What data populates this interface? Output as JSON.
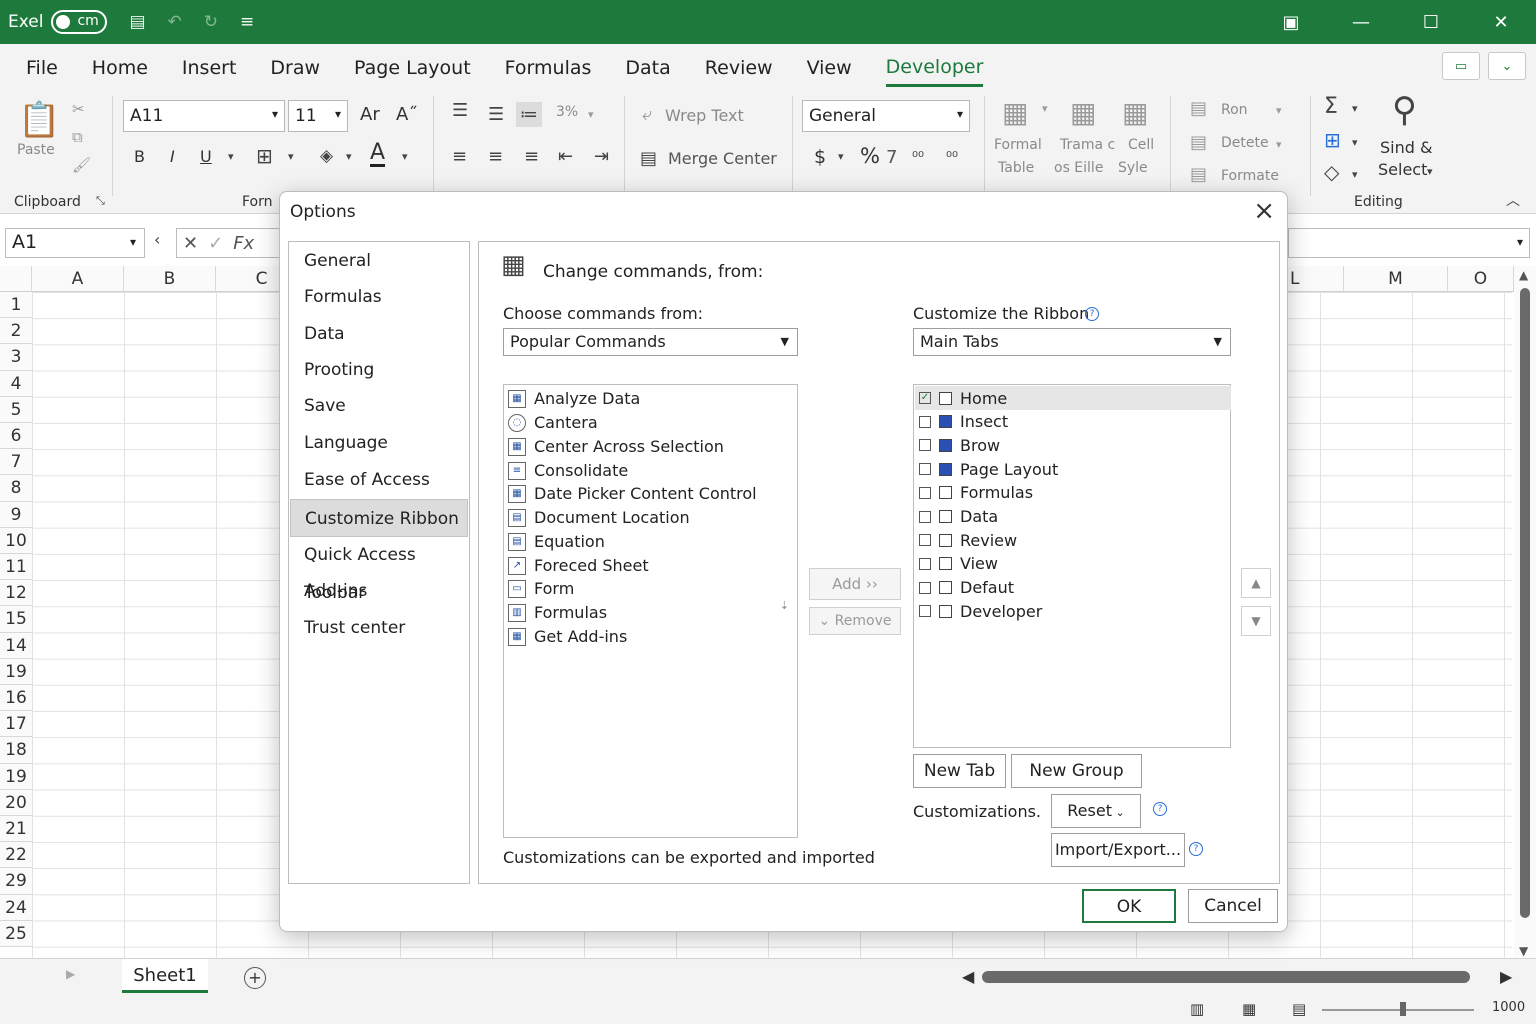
{
  "app": {
    "name": "Exel",
    "autosave_label": "cm"
  },
  "tabs": [
    "File",
    "Home",
    "Insert",
    "Draw",
    "Page Layout",
    "Formulas",
    "Data",
    "Review",
    "View",
    "Developer"
  ],
  "ribbon": {
    "clipboard_label": "Clipboard",
    "paste": "Paste",
    "font_group_label": "Forn",
    "font_name": "A11",
    "font_size": "11",
    "grow": "Ar",
    "shrink": "A˝",
    "bold": "B",
    "italic": "I",
    "underline": "U",
    "font_color": "A",
    "indent_pct": "3%",
    "wrap_text": "Wrep Text",
    "merge_center": "Merge Center",
    "number_format": "General",
    "currency": "$",
    "percent": "%",
    "comma": "7",
    "formal_table": "Formal",
    "formal_table2": "Table",
    "trama": "Trama c",
    "trama2": "os Eille",
    "cell": "Cell",
    "cell2": "Syle",
    "ron": "Ron",
    "delete": "Detete",
    "format": "Formate",
    "sind": "Sind &",
    "select": "Select",
    "editing_label": "Editing"
  },
  "formula_bar": {
    "name_box": "A1",
    "fx": "Fx"
  },
  "grid": {
    "columns": [
      "A",
      "B",
      "C",
      "L",
      "M",
      "O"
    ],
    "rows": [
      "1",
      "2",
      "3",
      "4",
      "5",
      "6",
      "7",
      "8",
      "9",
      "10",
      "11",
      "12",
      "15",
      "14",
      "19",
      "16",
      "17",
      "18",
      "19",
      "20",
      "21",
      "22",
      "29",
      "24",
      "25"
    ]
  },
  "sheet": {
    "tab": "Sheet1",
    "zoom": "1000"
  },
  "dialog": {
    "title": "Options",
    "nav": [
      "General",
      "Formulas",
      "Data",
      "Prooting",
      "Save",
      "Language",
      "Ease of Access",
      "Customize Ribbon",
      "Quick Access Toolbar",
      "Add-ins",
      "Trust center"
    ],
    "active_nav": "Customize Ribbon",
    "heading": "Change commands, from:",
    "choose_label": "Choose commands from:",
    "choose_value": "Popular Commands",
    "customize_label": "Customize the Ribbon",
    "customize_value": "Main Tabs",
    "commands": [
      "Analyze Data",
      "Cantera",
      "Center Across Selection",
      "Consolidate",
      "Date Picker Content Control",
      "Document Location",
      "Equation",
      "Foreced Sheet",
      "Form",
      "Formulas",
      "Get Add-ins"
    ],
    "ribbon_tabs": [
      {
        "label": "Home",
        "checked": true
      },
      {
        "label": "Insect",
        "checked": false
      },
      {
        "label": "Brow",
        "checked": false
      },
      {
        "label": "Page Layout",
        "checked": false
      },
      {
        "label": "Formulas",
        "checked": false
      },
      {
        "label": "Data",
        "checked": false
      },
      {
        "label": "Review",
        "checked": false
      },
      {
        "label": "View",
        "checked": false
      },
      {
        "label": "Defaut",
        "checked": false
      },
      {
        "label": "Developer",
        "checked": false
      }
    ],
    "add": "Add ››",
    "remove": "Remove",
    "new_tab": "New Tab",
    "new_group": "New Group",
    "customizations_label": "Customizations.",
    "reset": "Reset",
    "import_export": "Import/Export...",
    "footer_note": "Customizations can be exported and imported",
    "ok": "OK",
    "cancel": "Cancel"
  },
  "colors": {
    "brand": "#1e7a3c",
    "ribbon_bg": "#f3f3f3",
    "info": "#2a6fd6"
  }
}
